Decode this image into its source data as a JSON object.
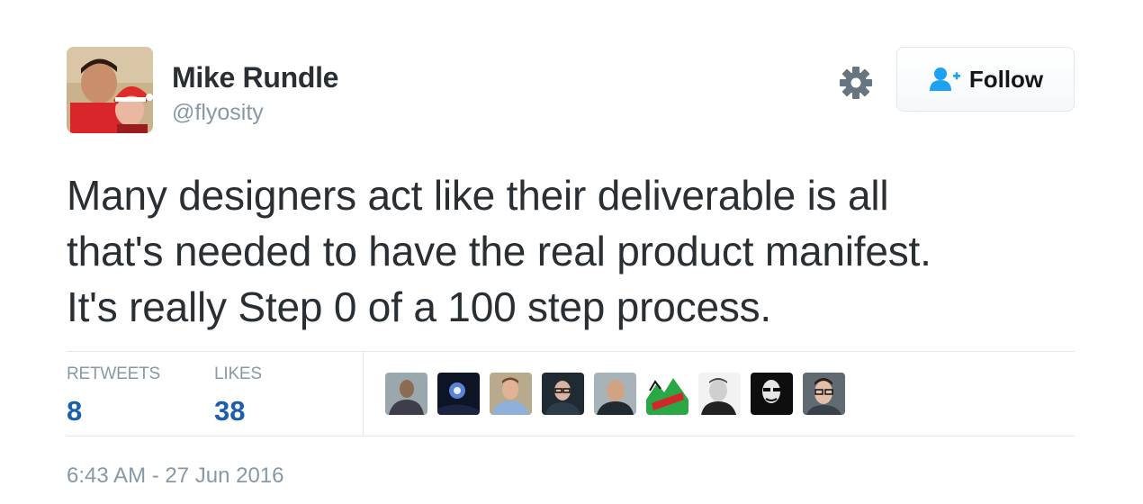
{
  "author": {
    "name": "Mike Rundle",
    "handle": "@flyosity",
    "avatar_icon": "profile-photo"
  },
  "actions": {
    "settings_icon": "gear-icon",
    "follow_label": "Follow",
    "follow_icon": "add-user-icon"
  },
  "tweet": {
    "text": "Many designers act like their deliverable is all\nthat's needed to have the real product manifest.\nIt's really Step 0 of a 100 step process."
  },
  "stats": {
    "retweets_label": "RETWEETS",
    "retweets_count": "8",
    "likes_label": "LIKES",
    "likes_count": "38"
  },
  "likers": [
    {
      "icon": "liker-avatar-1"
    },
    {
      "icon": "liker-avatar-2"
    },
    {
      "icon": "liker-avatar-3"
    },
    {
      "icon": "liker-avatar-4"
    },
    {
      "icon": "liker-avatar-5"
    },
    {
      "icon": "liker-avatar-6-mountain-dew"
    },
    {
      "icon": "liker-avatar-7"
    },
    {
      "icon": "liker-avatar-8"
    },
    {
      "icon": "liker-avatar-9"
    }
  ],
  "timestamp": "6:43 AM - 27 Jun 2016",
  "colors": {
    "link_blue": "#1b5faa",
    "muted_gray": "#8899a6",
    "text_dark": "#292f33",
    "border": "#e1e8ed",
    "follow_icon_blue": "#1da1f2"
  }
}
